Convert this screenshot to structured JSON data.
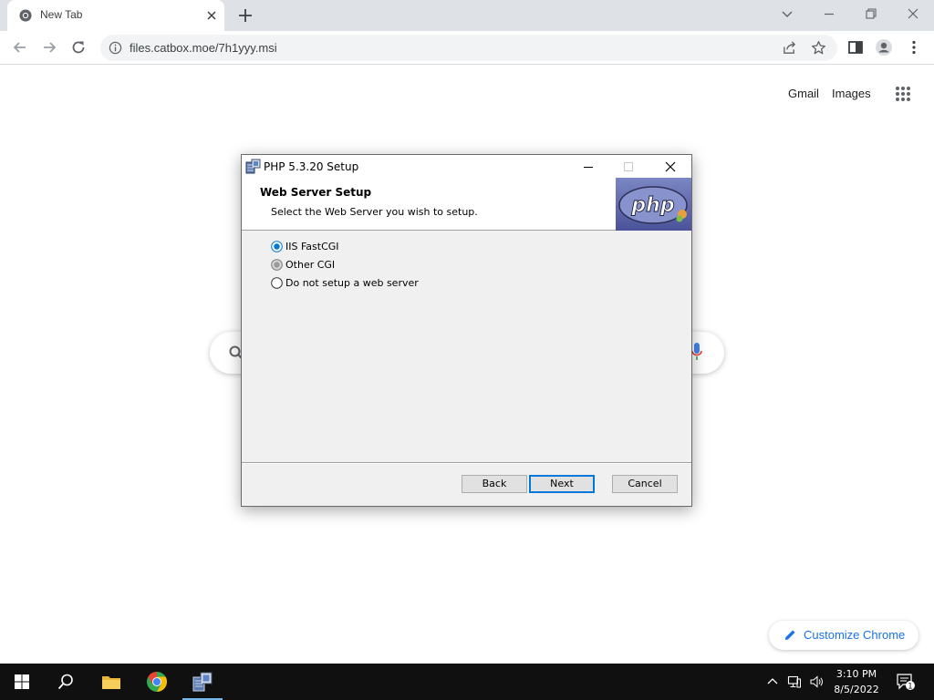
{
  "browser": {
    "tab_title": "New Tab",
    "url": "files.catbox.moe/7h1yyy.msi"
  },
  "ntp": {
    "gmail_label": "Gmail",
    "images_label": "Images",
    "customize_label": "Customize Chrome"
  },
  "dialog": {
    "window_title": "PHP 5.3.20 Setup",
    "heading": "Web Server Setup",
    "subheading": "Select the Web Server you wish to setup.",
    "logo_text": "php",
    "options": [
      {
        "label": "IIS FastCGI",
        "selected": true
      },
      {
        "label": "Other CGI",
        "selected": false
      },
      {
        "label": "Do not setup a web server",
        "selected": false
      }
    ],
    "buttons": {
      "back": "Back",
      "next": "Next",
      "cancel": "Cancel"
    }
  },
  "taskbar": {
    "time": "3:10 PM",
    "date": "8/5/2022",
    "notification_count": "1"
  },
  "colors": {
    "chrome_frame": "#dee1e6",
    "accent_blue": "#1a73e8",
    "dialog_bg": "#f0f0f0",
    "taskbar": "#101010",
    "default_button_border": "#0078d7"
  }
}
